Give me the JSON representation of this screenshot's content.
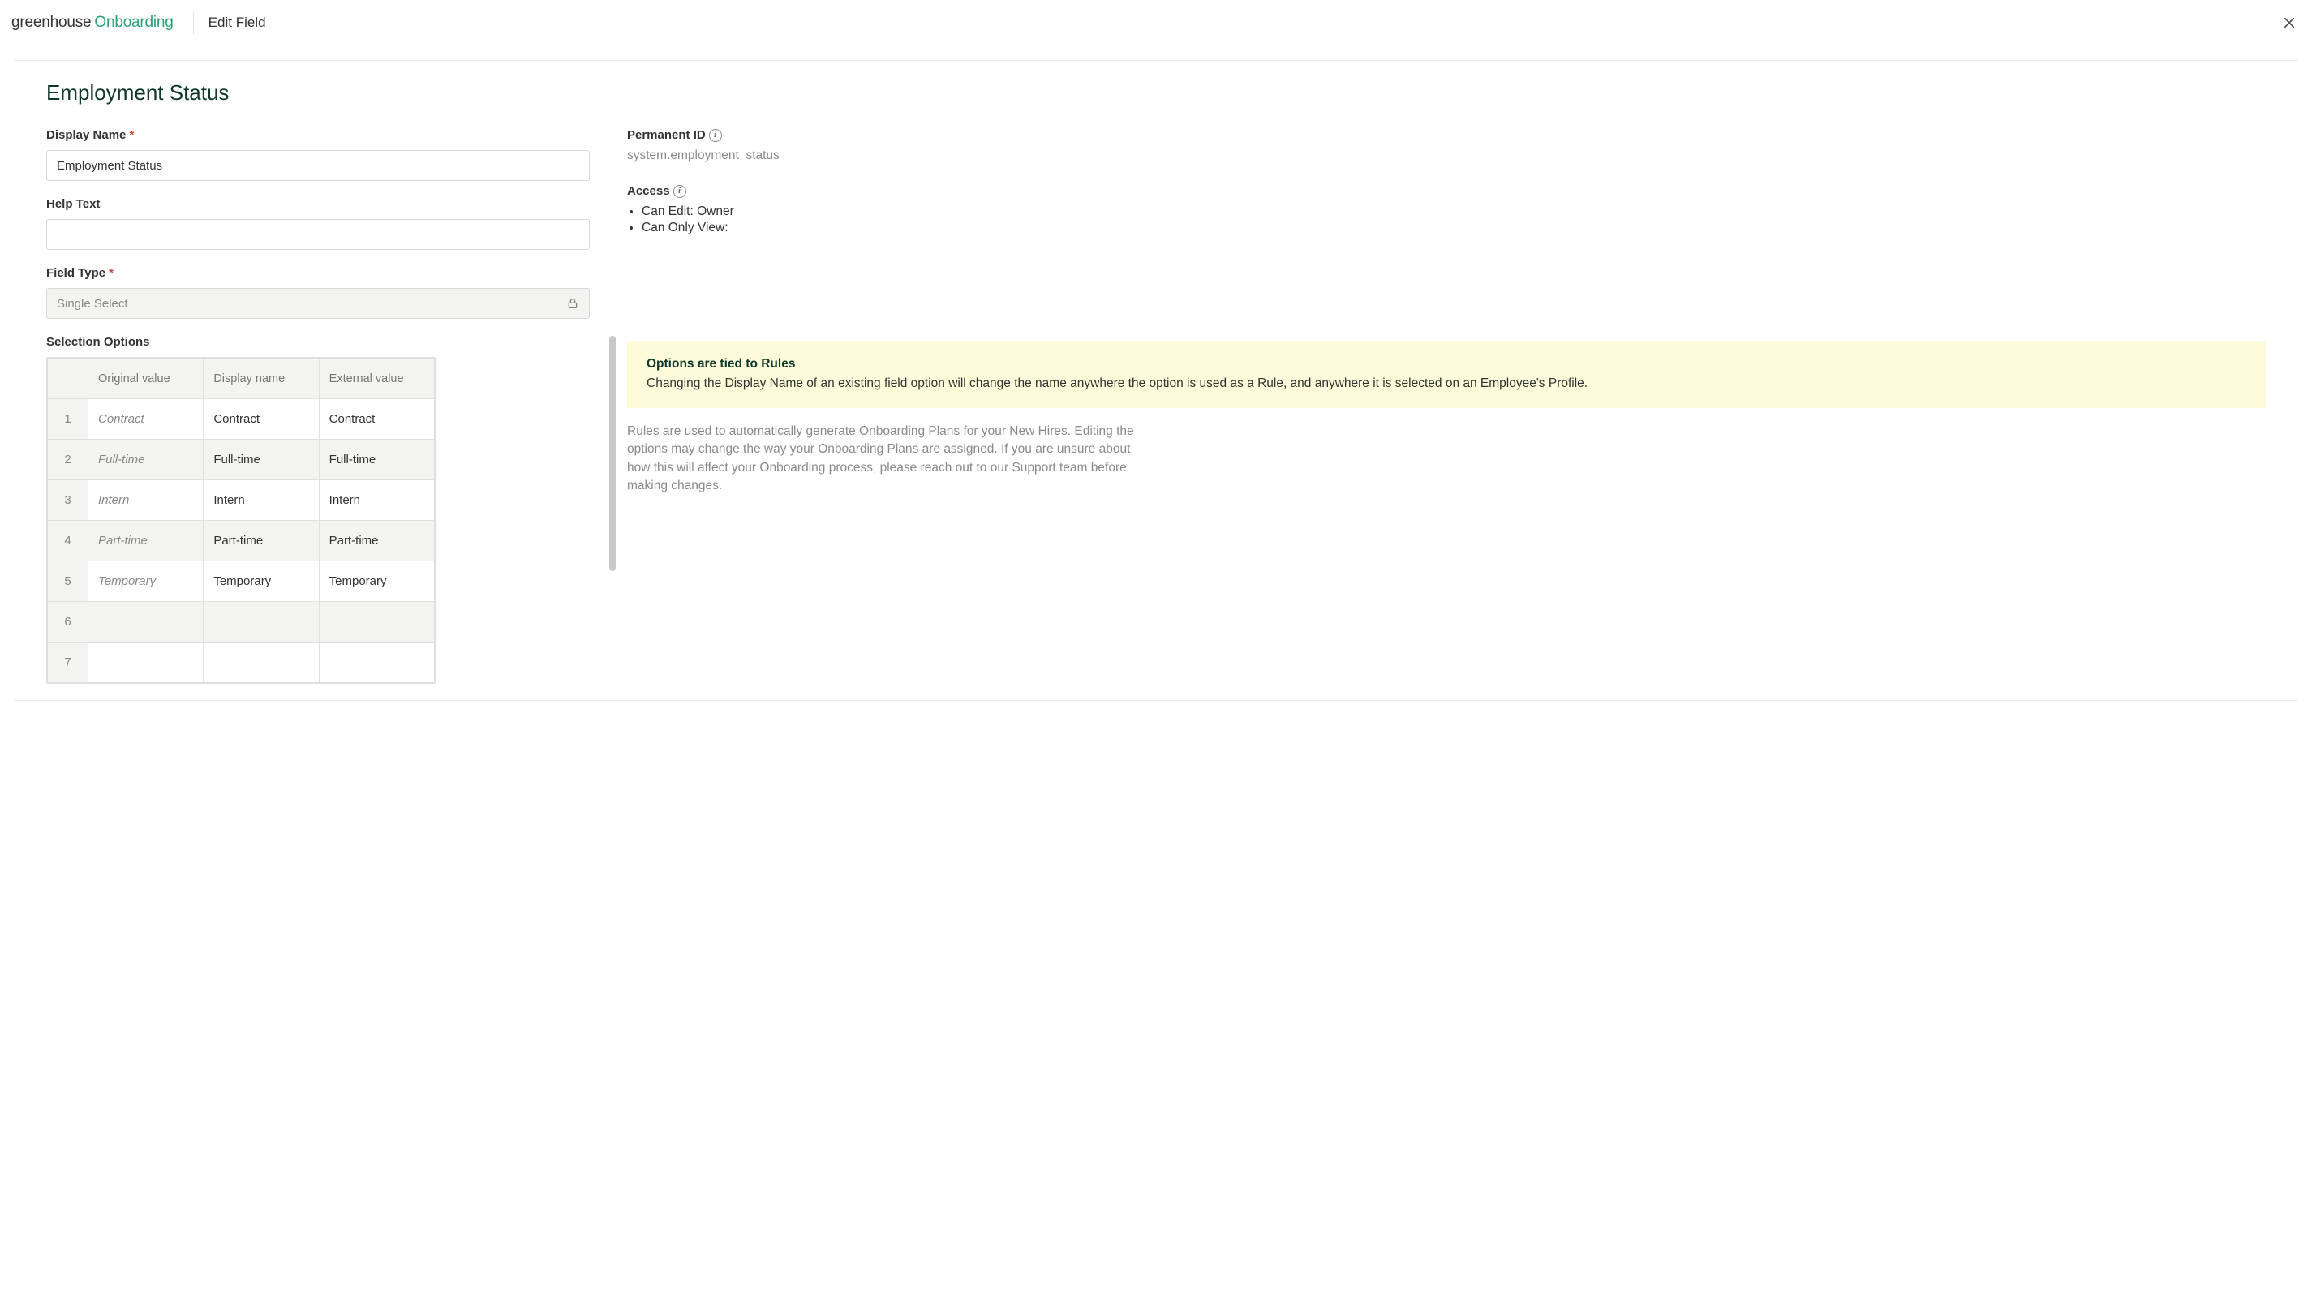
{
  "brand": {
    "part1": "greenhouse",
    "part2": "Onboarding"
  },
  "topbar": {
    "title": "Edit Field"
  },
  "page": {
    "title": "Employment Status"
  },
  "form": {
    "display_name_label": "Display Name",
    "display_name_value": "Employment Status",
    "help_text_label": "Help Text",
    "help_text_value": "",
    "field_type_label": "Field Type",
    "field_type_value": "Single Select",
    "selection_options_label": "Selection Options",
    "table": {
      "headers": {
        "original": "Original value",
        "display": "Display name",
        "external": "External value"
      },
      "rows": [
        {
          "n": "1",
          "original": "Contract",
          "display": "Contract",
          "external": "Contract"
        },
        {
          "n": "2",
          "original": "Full-time",
          "display": "Full-time",
          "external": "Full-time"
        },
        {
          "n": "3",
          "original": "Intern",
          "display": "Intern",
          "external": "Intern"
        },
        {
          "n": "4",
          "original": "Part-time",
          "display": "Part-time",
          "external": "Part-time"
        },
        {
          "n": "5",
          "original": "Temporary",
          "display": "Temporary",
          "external": "Temporary"
        },
        {
          "n": "6",
          "original": "",
          "display": "",
          "external": ""
        },
        {
          "n": "7",
          "original": "",
          "display": "",
          "external": ""
        }
      ]
    }
  },
  "side": {
    "permanent_id_label": "Permanent ID",
    "permanent_id_value": "system.employment_status",
    "access_label": "Access",
    "access": {
      "can_edit_label": "Can Edit:",
      "can_edit_value": "Owner",
      "can_view_label": "Can Only View:",
      "can_view_value": ""
    },
    "notice_title": "Options are tied to Rules",
    "notice_body": "Changing the Display Name of an existing field option will change the name anywhere the option is used as a Rule, and anywhere it is selected on an Employee's Profile.",
    "rules_para": "Rules are used to automatically generate Onboarding Plans for your New Hires. Editing the options may change the way your Onboarding Plans are assigned. If you are unsure about how this will affect your Onboarding process, please reach out to our Support team before making changes."
  }
}
